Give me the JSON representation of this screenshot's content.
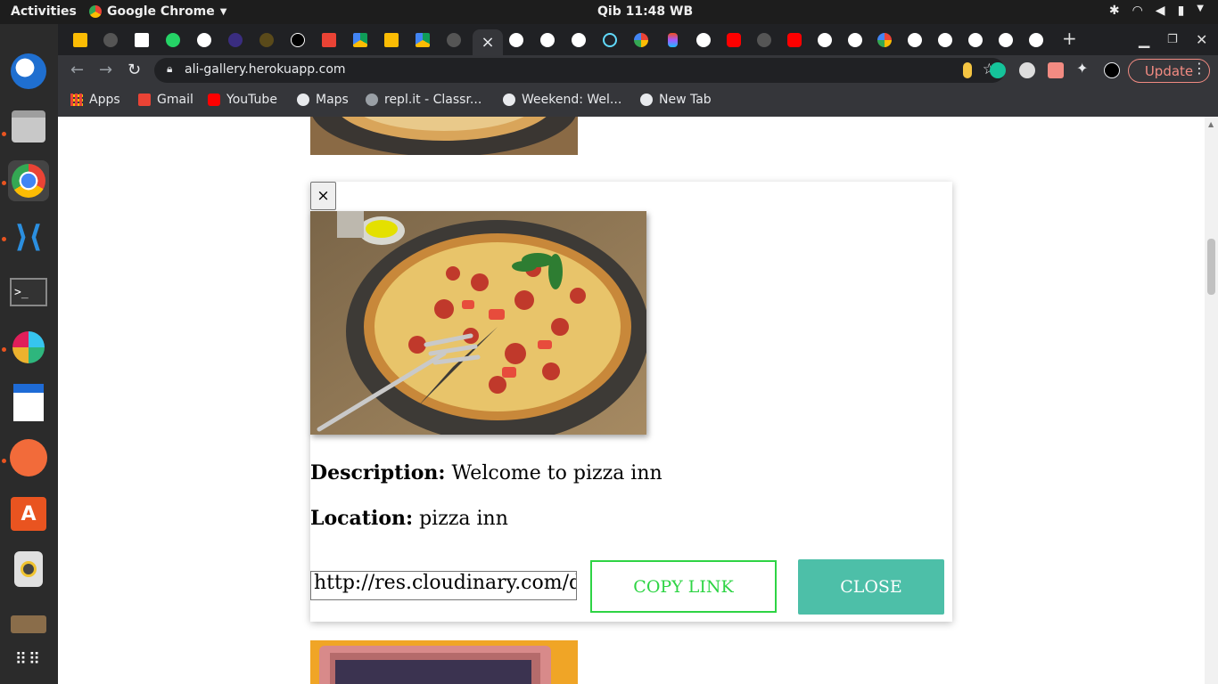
{
  "system": {
    "activities": "Activities",
    "app_name": "Google Chrome",
    "clock": "Qib 11:48 WB"
  },
  "browser": {
    "url": "ali-gallery.herokuapp.com",
    "update_label": "Update",
    "new_tab_symbol": "+",
    "close_tab_symbol": "×"
  },
  "bookmarks": [
    {
      "label": "Apps",
      "color": "#ea4335"
    },
    {
      "label": "Gmail",
      "color": "#ea4335"
    },
    {
      "label": "YouTube",
      "color": "#ff0000"
    },
    {
      "label": "Maps",
      "color": "#e8eaed"
    },
    {
      "label": "repl.it - Classr...",
      "color": "#9aa0a6"
    },
    {
      "label": "Weekend: Wel...",
      "color": "#e8eaed"
    },
    {
      "label": "New Tab",
      "color": "#e8eaed"
    }
  ],
  "modal": {
    "close_x": "×",
    "description_label": "Description:",
    "description_value": " Welcome to pizza inn",
    "location_label": "Location:",
    "location_value": " pizza inn",
    "link_value": "http://res.cloudinary.com/dyoc",
    "copy_label": "COPY LINK",
    "close_label": "CLOSE"
  },
  "colors": {
    "copy_accent": "#2ed444",
    "close_bg": "#4dbfa8"
  }
}
